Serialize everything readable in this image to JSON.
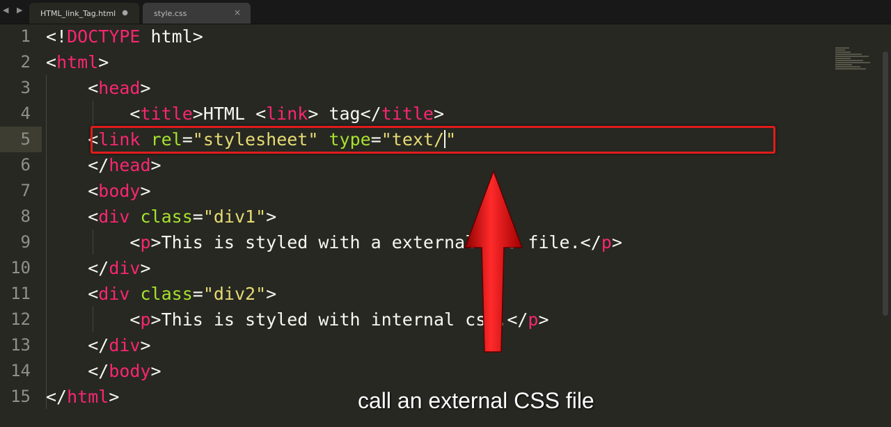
{
  "tabs": [
    {
      "label": "HTML_link_Tag.html",
      "active": true,
      "modified": true
    },
    {
      "label": "style.css",
      "active": false,
      "modified": false
    }
  ],
  "nav_arrows": "◀ ▶",
  "tab_modified_glyph": "●",
  "tab_close_glyph": "×",
  "line_numbers": [
    "1",
    "2",
    "3",
    "4",
    "5",
    "6",
    "7",
    "8",
    "9",
    "10",
    "11",
    "12",
    "13",
    "14",
    "15"
  ],
  "current_line": 5,
  "code": [
    [
      [
        "p",
        "<!"
      ],
      [
        "t",
        "DOCTYPE"
      ],
      [
        "x",
        " html"
      ],
      [
        "p",
        ">"
      ]
    ],
    [
      [
        "p",
        "<"
      ],
      [
        "t",
        "html"
      ],
      [
        "p",
        ">"
      ]
    ],
    [
      [
        "x",
        "    "
      ],
      [
        "p",
        "<"
      ],
      [
        "t",
        "head"
      ],
      [
        "p",
        ">"
      ]
    ],
    [
      [
        "x",
        "        "
      ],
      [
        "p",
        "<"
      ],
      [
        "t",
        "title"
      ],
      [
        "p",
        ">"
      ],
      [
        "x",
        "HTML <"
      ],
      [
        "t",
        "link"
      ],
      [
        "x",
        "> tag"
      ],
      [
        "p",
        "</"
      ],
      [
        "t",
        "title"
      ],
      [
        "p",
        ">"
      ]
    ],
    [
      [
        "x",
        "    "
      ],
      [
        "p",
        "<"
      ],
      [
        "t",
        "link"
      ],
      [
        "x",
        " "
      ],
      [
        "a",
        "rel"
      ],
      [
        "p",
        "="
      ],
      [
        "s",
        "\"stylesheet\""
      ],
      [
        "x",
        " "
      ],
      [
        "a",
        "type"
      ],
      [
        "p",
        "="
      ],
      [
        "s",
        "\"text/"
      ],
      [
        "cursor",
        ""
      ],
      [
        "s",
        "\""
      ]
    ],
    [
      [
        "x",
        "    "
      ],
      [
        "p",
        "</"
      ],
      [
        "t",
        "head"
      ],
      [
        "p",
        ">"
      ]
    ],
    [
      [
        "x",
        "    "
      ],
      [
        "p",
        "<"
      ],
      [
        "t",
        "body"
      ],
      [
        "p",
        ">"
      ]
    ],
    [
      [
        "x",
        "    "
      ],
      [
        "p",
        "<"
      ],
      [
        "t",
        "div"
      ],
      [
        "x",
        " "
      ],
      [
        "a",
        "class"
      ],
      [
        "p",
        "="
      ],
      [
        "s",
        "\"div1\""
      ],
      [
        "p",
        ">"
      ]
    ],
    [
      [
        "x",
        "        "
      ],
      [
        "p",
        "<"
      ],
      [
        "t",
        "p"
      ],
      [
        "p",
        ">"
      ],
      [
        "x",
        "This is styled with a external css file."
      ],
      [
        "p",
        "</"
      ],
      [
        "t",
        "p"
      ],
      [
        "p",
        ">"
      ]
    ],
    [
      [
        "x",
        "    "
      ],
      [
        "p",
        "</"
      ],
      [
        "t",
        "div"
      ],
      [
        "p",
        ">"
      ]
    ],
    [
      [
        "x",
        "    "
      ],
      [
        "p",
        "<"
      ],
      [
        "t",
        "div"
      ],
      [
        "x",
        " "
      ],
      [
        "a",
        "class"
      ],
      [
        "p",
        "="
      ],
      [
        "s",
        "\"div2\""
      ],
      [
        "p",
        ">"
      ]
    ],
    [
      [
        "x",
        "        "
      ],
      [
        "p",
        "<"
      ],
      [
        "t",
        "p"
      ],
      [
        "p",
        ">"
      ],
      [
        "x",
        "This is styled with internal css."
      ],
      [
        "p",
        "</"
      ],
      [
        "t",
        "p"
      ],
      [
        "p",
        ">"
      ]
    ],
    [
      [
        "x",
        "    "
      ],
      [
        "p",
        "</"
      ],
      [
        "t",
        "div"
      ],
      [
        "p",
        ">"
      ]
    ],
    [
      [
        "x",
        "    "
      ],
      [
        "p",
        "</"
      ],
      [
        "t",
        "body"
      ],
      [
        "p",
        ">"
      ]
    ],
    [
      [
        "p",
        "</"
      ],
      [
        "t",
        "html"
      ],
      [
        "p",
        ">"
      ]
    ]
  ],
  "caption": "call an external CSS file",
  "colors": {
    "background": "#272822",
    "tag": "#f92672",
    "attribute": "#a6e22e",
    "string": "#e6db74",
    "text": "#f8f8f2",
    "highlight_box": "#e21b1b",
    "arrow": "#cc0000"
  }
}
